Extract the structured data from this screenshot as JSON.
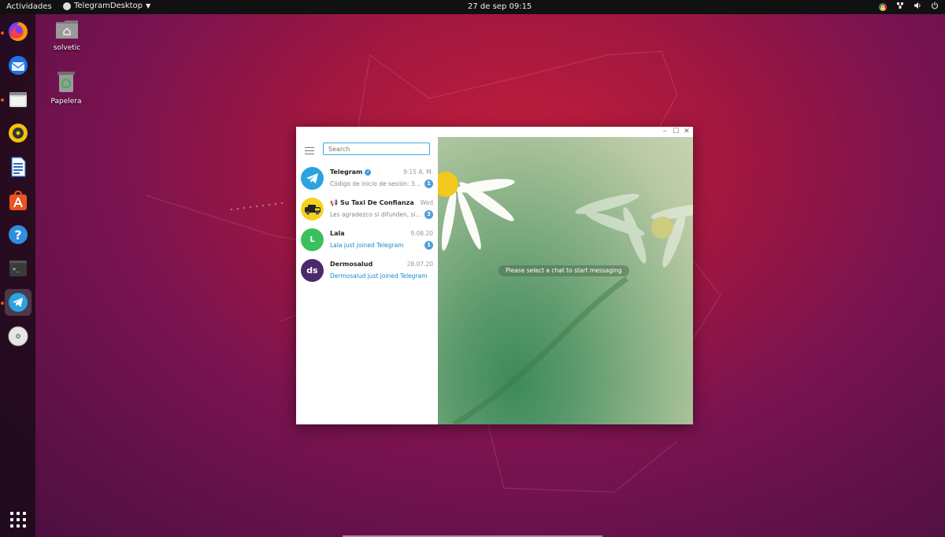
{
  "topbar": {
    "activities": "Actividades",
    "app_name": "TelegramDesktop",
    "clock": "27 de sep  09:15"
  },
  "dock": {
    "items": [
      "firefox-icon",
      "thunderbird-icon",
      "files-icon",
      "rhythmbox-icon",
      "writer-icon",
      "software-icon",
      "help-icon",
      "terminal-icon",
      "telegram-icon",
      "dvd-icon"
    ],
    "accent": "#e95420"
  },
  "desktop": {
    "icons": [
      {
        "label": "solvetic"
      },
      {
        "label": "Papelera"
      }
    ]
  },
  "telegram": {
    "search_placeholder": "Search",
    "chats": [
      {
        "name": "Telegram",
        "time": "9:15 A. M.",
        "message": "Código de inicio de sesión: 3...",
        "badge": "1",
        "initial": ""
      },
      {
        "name": "Su Taxi De Confianza",
        "time": "Wed",
        "message": "Les agradezco si difunden, si...",
        "badge": "3",
        "initial": ""
      },
      {
        "name": "Lala",
        "time": "9.08.20",
        "message": "Lala just joined Telegram",
        "badge": "1",
        "initial": "L"
      },
      {
        "name": "Dermosalud",
        "time": "28.07.20",
        "message": "Dermosalud just joined Telegram",
        "badge": "",
        "initial": "ds"
      }
    ],
    "empty_state": "Please select a chat to start messaging",
    "accent": "#40a7e3"
  }
}
